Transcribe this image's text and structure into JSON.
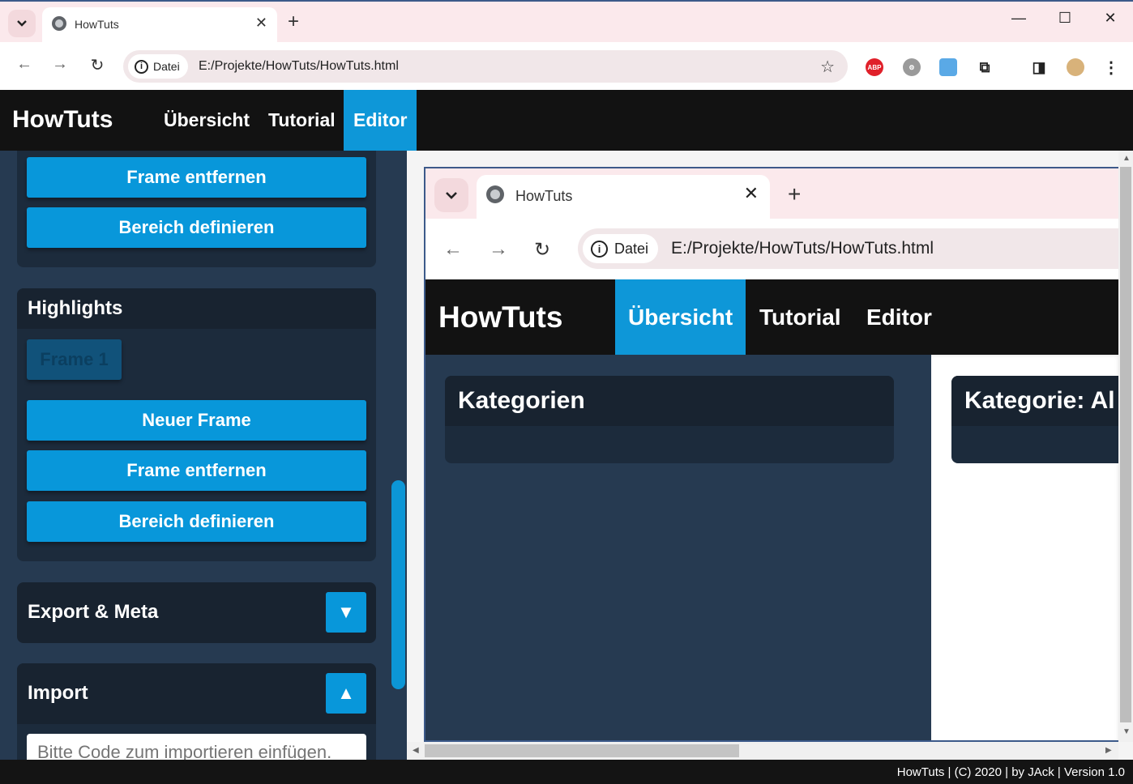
{
  "browser": {
    "tab_title": "HowTuts",
    "security_chip": "Datei",
    "url": "E:/Projekte/HowTuts/HowTuts.html",
    "extensions": [
      "adblock-icon",
      "settings-icon",
      "puzzle-icon",
      "extensions-icon",
      "sidebar-icon",
      "profile-avatar"
    ]
  },
  "app": {
    "brand": "HowTuts",
    "nav": [
      {
        "label": "Übersicht",
        "active": false
      },
      {
        "label": "Tutorial",
        "active": false
      },
      {
        "label": "Editor",
        "active": true
      }
    ]
  },
  "sidebar": {
    "top_panel": {
      "buttons": [
        "Frame entfernen",
        "Bereich definieren"
      ]
    },
    "highlights": {
      "title": "Highlights",
      "frame_chip": "Frame 1",
      "buttons": [
        "Neuer Frame",
        "Frame entfernen",
        "Bereich definieren"
      ]
    },
    "export": {
      "title": "Export & Meta",
      "toggle": "▼"
    },
    "import": {
      "title": "Import",
      "toggle": "▲",
      "placeholder": "Bitte Code zum importieren einfügen."
    }
  },
  "preview": {
    "tab_title": "HowTuts",
    "security_chip": "Datei",
    "url": "E:/Projekte/HowTuts/HowTuts.html",
    "brand": "HowTuts",
    "nav": [
      {
        "label": "Übersicht",
        "active": true
      },
      {
        "label": "Tutorial",
        "active": false
      },
      {
        "label": "Editor",
        "active": false
      }
    ],
    "card_left_title": "Kategorien",
    "card_right_title": "Kategorie: Al"
  },
  "footer": {
    "text": "HowTuts | (C) 2020 | by JAck | Version 1.0"
  },
  "colors": {
    "accent": "#0e97d8",
    "header": "#121212",
    "sidebar": "#263a51",
    "panel": "#1c2b3c"
  }
}
